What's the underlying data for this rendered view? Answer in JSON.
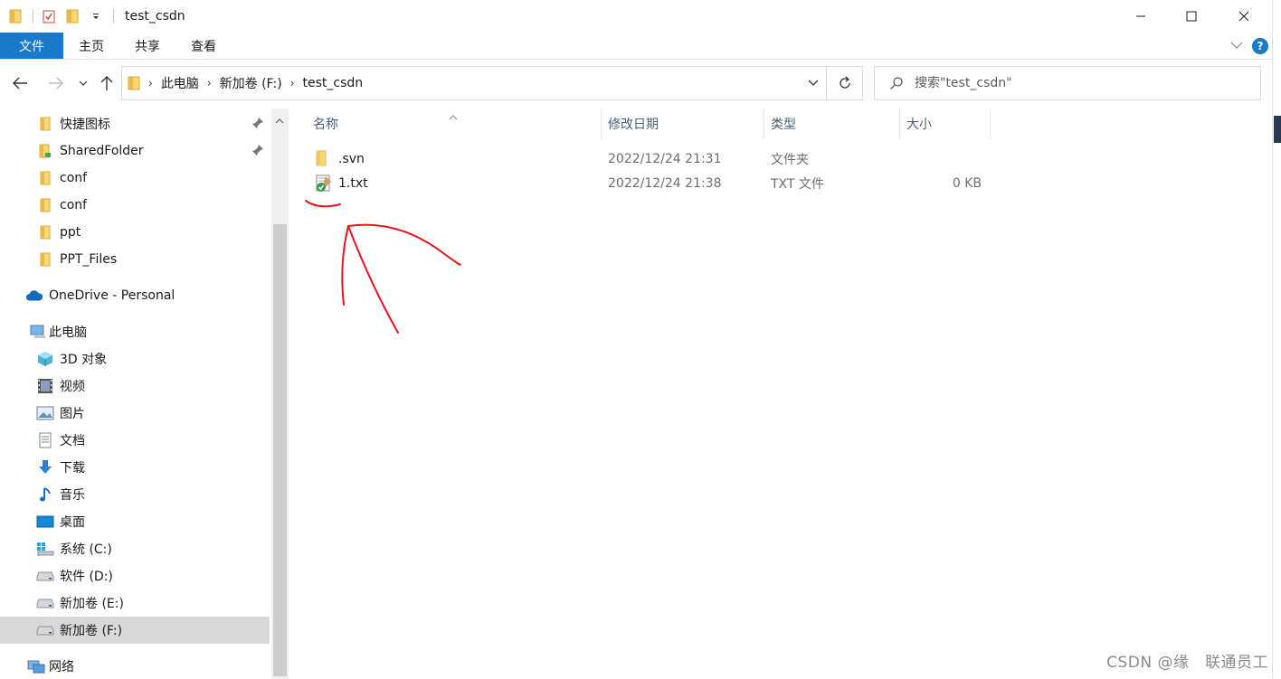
{
  "window": {
    "title": "test_csdn",
    "controls": [
      "minimize",
      "maximize",
      "close"
    ]
  },
  "ribbon": {
    "tabs": [
      "文件",
      "主页",
      "共享",
      "查看"
    ],
    "help_label": "?"
  },
  "address": {
    "crumbs": [
      "此电脑",
      "新加卷 (F:)",
      "test_csdn"
    ]
  },
  "search": {
    "placeholder": "搜索\"test_csdn\""
  },
  "nav": {
    "quick_access": [
      {
        "label": "快捷图标",
        "icon": "folder-icon",
        "pinned": true
      },
      {
        "label": "SharedFolder",
        "icon": "shared-folder-icon",
        "pinned": true
      },
      {
        "label": "conf",
        "icon": "folder-icon",
        "pinned": false
      },
      {
        "label": "conf",
        "icon": "folder-icon",
        "pinned": false
      },
      {
        "label": "ppt",
        "icon": "folder-icon",
        "pinned": false
      },
      {
        "label": "PPT_Files",
        "icon": "folder-icon",
        "pinned": false
      }
    ],
    "onedrive": "OneDrive - Personal",
    "this_pc": "此电脑",
    "pc_items": [
      {
        "label": "3D 对象",
        "icon": "3d-objects-icon"
      },
      {
        "label": "视频",
        "icon": "video-icon"
      },
      {
        "label": "图片",
        "icon": "pictures-icon"
      },
      {
        "label": "文档",
        "icon": "documents-icon"
      },
      {
        "label": "下载",
        "icon": "download-icon"
      },
      {
        "label": "音乐",
        "icon": "music-icon"
      },
      {
        "label": "桌面",
        "icon": "desktop-icon"
      },
      {
        "label": "系统 (C:)",
        "icon": "windows-drive-icon"
      },
      {
        "label": "软件 (D:)",
        "icon": "drive-icon"
      },
      {
        "label": "新加卷 (E:)",
        "icon": "drive-icon"
      },
      {
        "label": "新加卷 (F:)",
        "icon": "drive-icon",
        "selected": true
      }
    ],
    "network": "网络"
  },
  "columns": {
    "name": "名称",
    "modified": "修改日期",
    "type": "类型",
    "size": "大小"
  },
  "files": [
    {
      "name": ".svn",
      "modified": "2022/12/24 21:31",
      "type": "文件夹",
      "size": "",
      "icon": "folder-icon"
    },
    {
      "name": "1.txt",
      "modified": "2022/12/24 21:38",
      "type": "TXT 文件",
      "size": "0 KB",
      "icon": "svn-text-file-icon"
    }
  ],
  "watermark": "CSDN @缘　联通员工",
  "colors": {
    "accent": "#1979ca",
    "folder": "#f8d775",
    "annotation": "#e8141a",
    "selected_bg": "#d9d9d9"
  }
}
